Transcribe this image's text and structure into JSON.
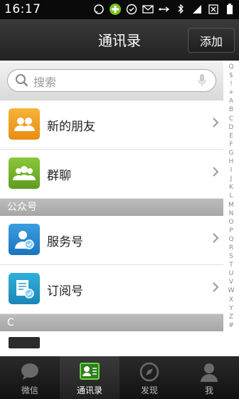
{
  "status_bar": {
    "time": "16:17"
  },
  "header": {
    "title": "通讯录",
    "add_label": "添加"
  },
  "search": {
    "placeholder": "搜索"
  },
  "rows": [
    {
      "label": "新的朋友",
      "icon": "new-friends-icon",
      "color": "#f0a020"
    },
    {
      "label": "群聊",
      "icon": "group-chat-icon",
      "color": "#79b62b"
    }
  ],
  "sections": {
    "official": "公众号",
    "c": "C"
  },
  "official_rows": [
    {
      "label": "服务号",
      "icon": "service-account-icon",
      "color": "#2b8fd6"
    },
    {
      "label": "订阅号",
      "icon": "subscription-account-icon",
      "color": "#1f9ad0"
    }
  ],
  "index_letters": [
    "Q",
    "$",
    "!",
    "+",
    "A",
    "B",
    "C",
    "D",
    "E",
    "F",
    "G",
    "H",
    "I",
    "J",
    "K",
    "L",
    "M",
    "N",
    "O",
    "P",
    "Q",
    "R",
    "S",
    "T",
    "U",
    "V",
    "W",
    "X",
    "Y",
    "Z",
    "#"
  ],
  "tabs": [
    {
      "label": "微信",
      "icon": "chat-icon"
    },
    {
      "label": "通讯录",
      "icon": "contacts-icon",
      "active": true
    },
    {
      "label": "发现",
      "icon": "discover-icon"
    },
    {
      "label": "我",
      "icon": "me-icon"
    }
  ]
}
